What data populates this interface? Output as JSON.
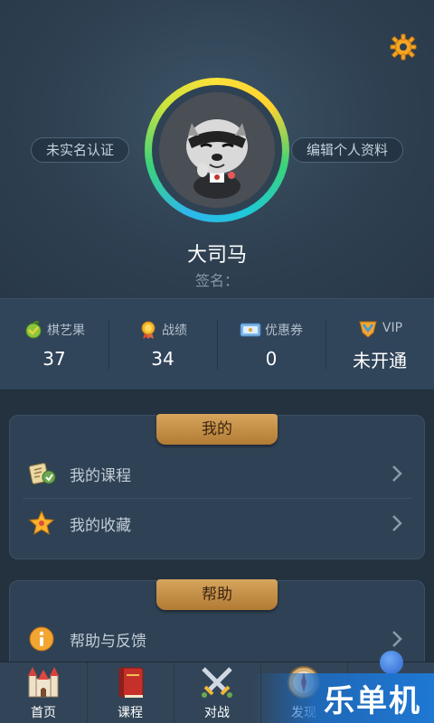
{
  "header": {
    "realname_label": "未实名认证",
    "edit_profile_label": "编辑个人资料",
    "username": "大司马",
    "signature": "签名："
  },
  "stats": [
    {
      "label": "棋艺果",
      "value": "37",
      "icon": "fruit-icon"
    },
    {
      "label": "战绩",
      "value": "34",
      "icon": "medal-icon"
    },
    {
      "label": "优惠券",
      "value": "0",
      "icon": "coupon-icon"
    },
    {
      "label": "VIP",
      "value": "未开通",
      "icon": "vip-badge-icon"
    }
  ],
  "mine": {
    "title": "我的",
    "items": [
      {
        "label": "我的课程",
        "icon": "course-book-icon"
      },
      {
        "label": "我的收藏",
        "icon": "star-icon"
      }
    ]
  },
  "help": {
    "title": "帮助",
    "items": [
      {
        "label": "帮助与反馈",
        "icon": "info-icon"
      }
    ]
  },
  "tabbar": [
    {
      "label": "首页",
      "icon": "castle-icon"
    },
    {
      "label": "课程",
      "icon": "book-icon"
    },
    {
      "label": "对战",
      "icon": "crossed-swords-icon"
    },
    {
      "label": "发现",
      "icon": "compass-icon"
    },
    {
      "label": "",
      "icon": "profile-icon"
    }
  ],
  "watermark": "乐单机",
  "colors": {
    "background": "#2c3e4f",
    "tab_gold": "#c8914a",
    "ring_yellow": "#ffe13a",
    "ring_cyan": "#1ec8d8",
    "watermark_blue": "#1f78d3"
  }
}
